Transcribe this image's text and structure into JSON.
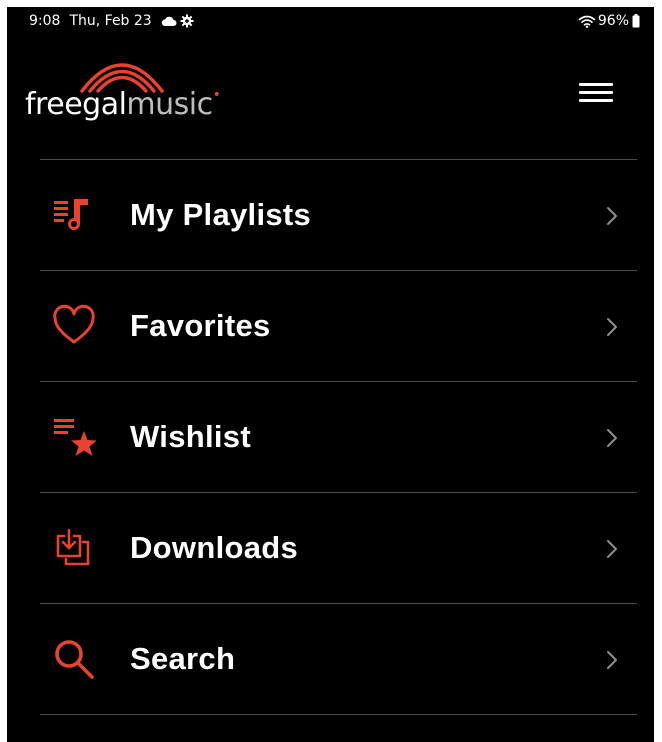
{
  "status_bar": {
    "time": "9:08",
    "date": "Thu, Feb 23",
    "battery": "96%",
    "icons": [
      "cloud-icon",
      "gear-icon",
      "wifi-icon",
      "battery-icon"
    ]
  },
  "header": {
    "logo_part1": "freegal",
    "logo_part2": "music",
    "menu_icon": "hamburger-menu-icon"
  },
  "colors": {
    "background": "#000000",
    "accent": "#e8432f",
    "text": "#ffffff",
    "divider": "#4a4a4a",
    "chevron": "#8e8e93"
  },
  "menu": {
    "items": [
      {
        "label": "My Playlists",
        "icon": "playlist-icon"
      },
      {
        "label": "Favorites",
        "icon": "heart-icon"
      },
      {
        "label": "Wishlist",
        "icon": "wishlist-star-icon"
      },
      {
        "label": "Downloads",
        "icon": "download-icon"
      },
      {
        "label": "Search",
        "icon": "search-icon"
      }
    ]
  }
}
